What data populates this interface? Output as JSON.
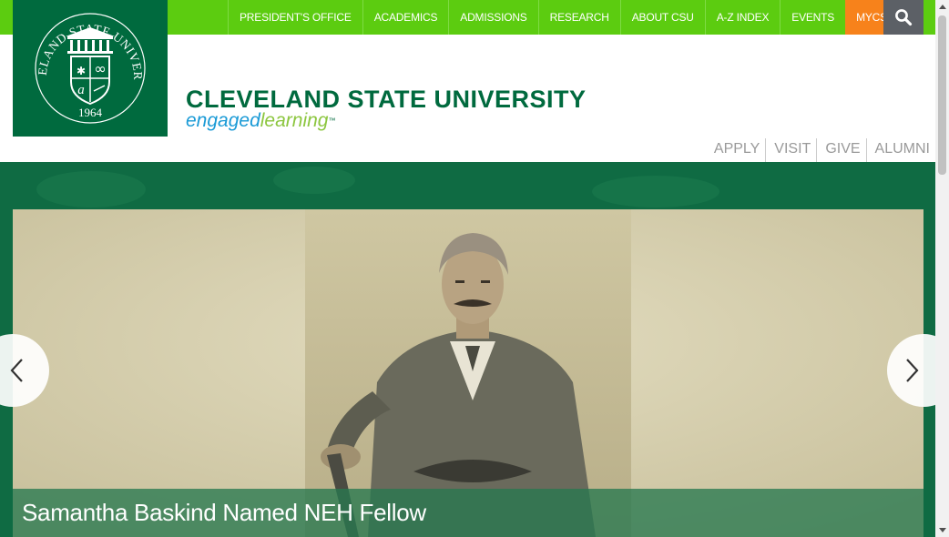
{
  "topnav": {
    "items": [
      "President's Office",
      "Academics",
      "Admissions",
      "Research",
      "About CSU",
      "A-Z Index",
      "Events"
    ],
    "mycsu": "MyCSU",
    "search_icon": "search-icon"
  },
  "seal": {
    "ring_text": "CLEVELAND STATE UNIVERSITY",
    "year": "1964",
    "shield_letter": "a",
    "shield_symbol": "∞"
  },
  "wordmark": {
    "title": "CLEVELAND STATE UNIVERSITY",
    "tag_engaged": "engaged",
    "tag_learning": "learning",
    "tag_tm": "™"
  },
  "quicklinks": [
    "Apply",
    "Visit",
    "Give",
    "Alumni"
  ],
  "hero": {
    "caption_title": "Samantha Baskind Named NEH Fellow",
    "prev_icon": "chevron-left-icon",
    "next_icon": "chevron-right-icon"
  },
  "colors": {
    "brand_green": "#006a3e",
    "nav_green": "#5ccc10",
    "mycsu_orange": "#f7821b",
    "search_gray": "#5c6066"
  }
}
